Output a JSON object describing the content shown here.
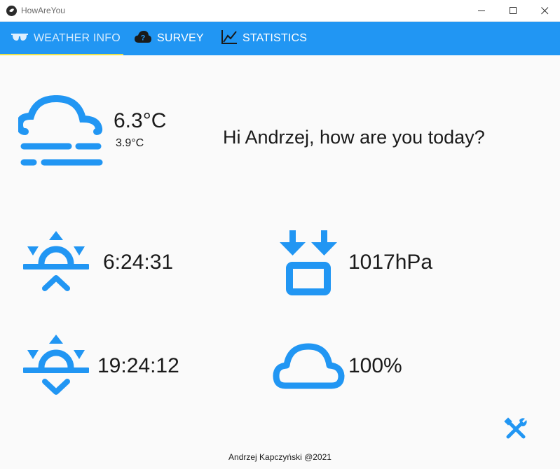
{
  "window": {
    "title": "HowAreYou"
  },
  "tabs": [
    {
      "label": "WEATHER INFO",
      "icon": "glasses-icon",
      "active": true
    },
    {
      "label": "SURVEY",
      "icon": "help-cloud-icon",
      "active": false
    },
    {
      "label": "STATISTICS",
      "icon": "chart-line-icon",
      "active": false
    }
  ],
  "weather": {
    "condition_icon": "weather-fog-icon",
    "temperature": "6.3°C",
    "feels_like": "3.9°C",
    "sunrise": "6:24:31",
    "sunset": "19:24:12",
    "pressure": "1017hPa",
    "cloudiness": "100%"
  },
  "greeting": "Hi Andrzej, how are you today?",
  "footer": "Andrzej Kapczyński @2021",
  "colors": {
    "accent": "#2196f3",
    "tab_indicator": "#e8e04a",
    "text": "#1a1a1a",
    "background": "#fafafa"
  }
}
